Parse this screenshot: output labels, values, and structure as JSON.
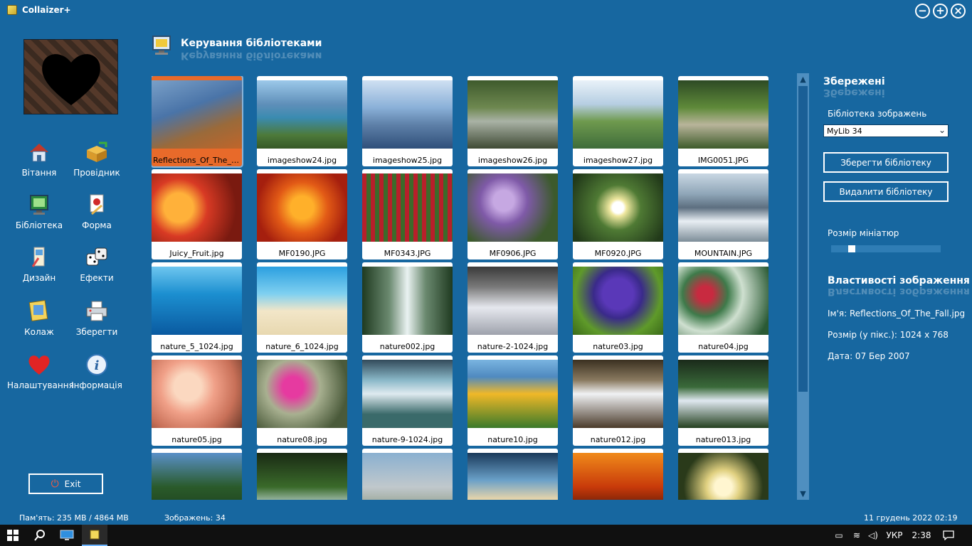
{
  "window": {
    "title": "Collaizer+"
  },
  "nav": [
    {
      "label": "Вітання",
      "icon": "house-icon"
    },
    {
      "label": "Провідник",
      "icon": "explorer-box-icon"
    },
    {
      "label": "Бібліотека",
      "icon": "library-monitor-icon"
    },
    {
      "label": "Форма",
      "icon": "form-palette-icon"
    },
    {
      "label": "Дизайн",
      "icon": "design-brush-icon"
    },
    {
      "label": "Ефекти",
      "icon": "dice-icon"
    },
    {
      "label": "Колаж",
      "icon": "collage-icon"
    },
    {
      "label": "Зберегти",
      "icon": "printer-icon"
    },
    {
      "label": "Налаштування",
      "icon": "heart-icon"
    },
    {
      "label": "Інформація",
      "icon": "info-icon"
    }
  ],
  "exit_label": "Exit",
  "header": {
    "title": "Керування бібліотеками"
  },
  "images": [
    "Reflections_Of_The_F...",
    "imageshow24.jpg",
    "imageshow25.jpg",
    "imageshow26.jpg",
    "imageshow27.jpg",
    "IMG0051.JPG",
    "Juicy_Fruit.jpg",
    "MF0190.JPG",
    "MF0343.JPG",
    "MF0906.JPG",
    "MF0920.JPG",
    "MOUNTAIN.JPG",
    "nature_5_1024.jpg",
    "nature_6_1024.jpg",
    "nature002.jpg",
    "nature-2-1024.jpg",
    "nature03.jpg",
    "nature04.jpg",
    "nature05.jpg",
    "nature08.jpg",
    "nature-9-1024.jpg",
    "nature10.jpg",
    "nature012.jpg",
    "nature013.jpg",
    "",
    "",
    "",
    "",
    "",
    ""
  ],
  "selected_index": 0,
  "right": {
    "saved_heading": "Збережені",
    "library_label": "Бібліотека зображень",
    "library_value": "MyLib 34",
    "save_button": "Зберегти бібліотеку",
    "delete_button": "Видалити бібліотеку",
    "thumb_size_label": "Розмір мініатюр",
    "thumb_size_fraction": 0.17,
    "props_heading": "Властивості зображення",
    "prop_name": "Ім'я: Reflections_Of_The_Fall.jpg",
    "prop_size": "Розмір (у пікс.): 1024 x 768",
    "prop_date": "Дата: 07 Бер 2007"
  },
  "status": {
    "memory": "Пам'ять: 235 MB / 4864 MB",
    "images": "Зображень: 34",
    "datetime": "11 грудень 2022   02:19"
  },
  "taskbar": {
    "lang": "УКР",
    "time": "2:38"
  }
}
